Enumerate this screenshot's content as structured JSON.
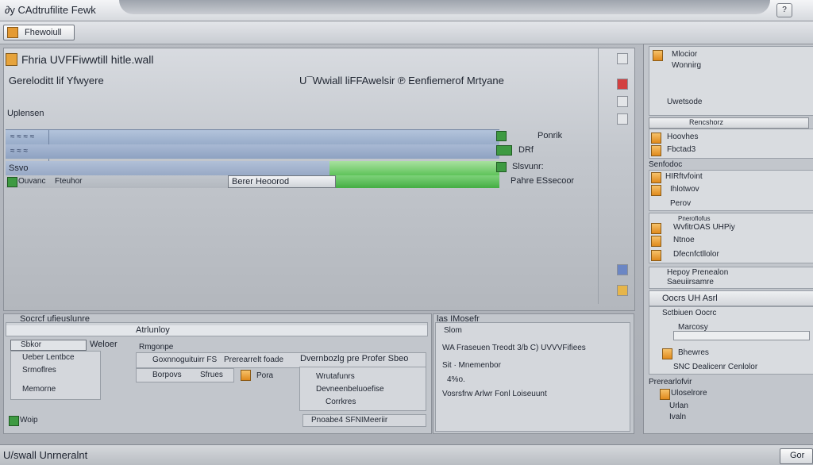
{
  "window": {
    "title": "∂y CAdtrufilite Fewk",
    "help_label": "?"
  },
  "toolbar": {
    "firewall_label": "Fhewoiull"
  },
  "main": {
    "app_title": "Fhria UVFFiwwtill hitle.wall",
    "subtitle_left": "Gereloditt lif Yfwyere",
    "subtitle_right": "U¯Wwiall liFFAwelsir ℗ Eenfiemerof Mrtyane",
    "section_label": "Uplensen",
    "bar1_left": "≈ ≈ ≈ ≈",
    "bar1_right": "Ponrik",
    "bar2_left": "≈ ≈ ≈",
    "bar2_right": "DRf",
    "bar3_left": "Ssvo",
    "bar3_right": "Slsvunr:",
    "bar4_left": "Ouvanc",
    "bar4_mid": "Fteuhor",
    "bar4_center_btn": "Berer   Heoorod",
    "bar4_right": "Pahre ESsecoor"
  },
  "bottom_left": {
    "header": "Socrcf ufieuslunre",
    "sub_header": "Atrlunloy",
    "tab_label": "Sbkor",
    "tab_right": "Weloer",
    "list_items": [
      "Ueber Lentbce",
      "Srmoflres",
      "Memorne"
    ],
    "col1_row1": "Rmgonpe",
    "col1_row2": "Goxnnoguituirr FS",
    "col1_row3": "Borpovs",
    "col2_row2": "Prerearrelt foade",
    "col2_row3": "Sfrues",
    "col3_row2": "Dvernbozlg  pre Profer Sbeo",
    "col3_row3": "Pora",
    "popup_items": [
      "Wrutafunrs",
      "Devneenbeluoefise",
      "Corrkres"
    ],
    "bottom_btn": "Pnoabe4  SFNIMeeriir",
    "footer_item": "Woip"
  },
  "bottom_mid": {
    "header": "las IMosefr",
    "row1": "Slom",
    "row2": "WA   Fraseuen Treodt 3/b C) UVVVFifiees",
    "row3": "Sit · Mnemenbor",
    "row4": "Vosrsfrw Arlwr Fonl Loiseuunt",
    "row_small": "4%o."
  },
  "right_panel": {
    "item1": "Mlocior",
    "item1b": "Wonnirg",
    "item2": "Uwetsode",
    "head1": "Rencshorz",
    "item3": "Hoovhes",
    "item4": "Fbctad3",
    "group2": "Senfodoc",
    "item5": "HIRftvfoint",
    "item6": "Ihlotwov",
    "item7": "Perov",
    "head2": "Pneroflofus",
    "item8": "WvfitrOAS UHPiy",
    "item9": "Ntnoe",
    "item10": "Dfecnfctllolor",
    "item11": "Hepoy Prenealon",
    "item12": "Saeuiirsamre",
    "group3": "Oocrs UH Asrl",
    "item13": "Sctbiuen Oocrc",
    "item14": "Marcosy",
    "item15": "Bhewres",
    "item16": "SNC Dealicenr Cenlolor",
    "group4": "Prerearlofvir",
    "item17": "Uloselrore",
    "item18": "Urlan",
    "item19": "Ivaln"
  },
  "status": {
    "text": "U/swall Unrneralnt",
    "button": "Gor"
  }
}
